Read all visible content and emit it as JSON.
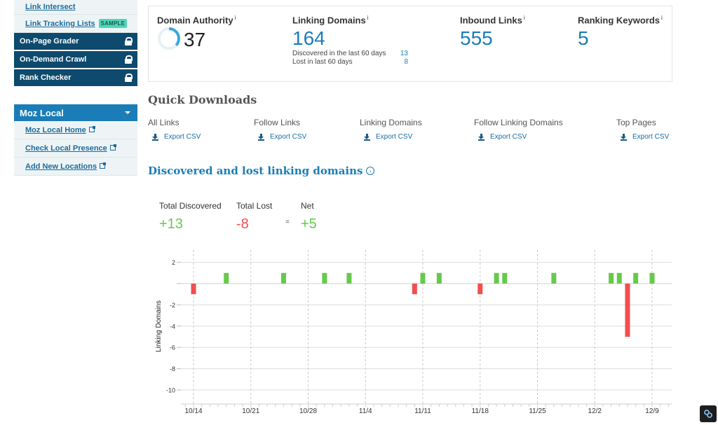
{
  "sidebar": {
    "top_links": [
      {
        "label": "Link Intersect"
      },
      {
        "label": "Link Tracking Lists",
        "badge": "SAMPLE"
      }
    ],
    "locked_items": [
      {
        "label": "On-Page Grader"
      },
      {
        "label": "On-Demand Crawl"
      },
      {
        "label": "Rank Checker"
      }
    ],
    "moz_local": {
      "title": "Moz Local",
      "links": [
        {
          "label": "Moz Local Home"
        },
        {
          "label": "Check Local Presence"
        },
        {
          "label": "Add New Locations"
        }
      ]
    }
  },
  "metrics": {
    "domain_authority": {
      "label": "Domain Authority",
      "info": "i",
      "value": "37",
      "score": 37
    },
    "linking_domains": {
      "label": "Linking Domains",
      "info": "i",
      "value": "164",
      "discovered_label": "Discovered in the last 60 days",
      "discovered_value": "13",
      "lost_label": "Lost in last 60 days",
      "lost_value": "8"
    },
    "inbound_links": {
      "label": "Inbound Links",
      "info": "i",
      "value": "555"
    },
    "ranking_keywords": {
      "label": "Ranking Keywords",
      "info": "i",
      "value": "5"
    }
  },
  "quick_downloads": {
    "title": "Quick Downloads",
    "items": [
      {
        "label": "All Links",
        "action": "Export CSV"
      },
      {
        "label": "Follow Links",
        "action": "Export CSV"
      },
      {
        "label": "Linking Domains",
        "action": "Export CSV"
      },
      {
        "label": "Follow Linking Domains",
        "action": "Export CSV"
      },
      {
        "label": "Top Pages",
        "action": "Export CSV"
      }
    ]
  },
  "discovered_lost": {
    "title": "Discovered and lost linking domains",
    "total_discovered_label": "Total Discovered",
    "total_discovered": "+13",
    "total_lost_label": "Total Lost",
    "total_lost": "-8",
    "equals": "=",
    "net_label": "Net",
    "net": "+5"
  },
  "colors": {
    "accent": "#1b7db7",
    "sidebar_dark": "#0e4a6e",
    "gained": "#67c94b",
    "lost": "#f24e4e"
  },
  "chart_data": {
    "type": "bar",
    "title": "",
    "xlabel": "",
    "ylabel": "Linking Domains",
    "ylim": [
      -11,
      2.5
    ],
    "yticks": [
      2,
      0,
      -2,
      -4,
      -6,
      -8,
      -10
    ],
    "ytick_labels": [
      "2",
      "",
      "-2",
      "-4",
      "-6",
      "-8",
      "-10"
    ],
    "x_range_days": [
      -2,
      58
    ],
    "xtick_days": [
      0,
      7,
      14,
      21,
      28,
      35,
      42,
      49,
      56
    ],
    "xtick_labels": [
      "10/14",
      "10/21",
      "10/28",
      "11/4",
      "11/11",
      "11/18",
      "11/25",
      "12/2",
      "12/9"
    ],
    "grid": true,
    "series": [
      {
        "name": "Discovered",
        "color": "#67c94b",
        "points": [
          {
            "date": "10/18",
            "day": 4,
            "value": 1
          },
          {
            "date": "10/25",
            "day": 11,
            "value": 1
          },
          {
            "date": "10/30",
            "day": 16,
            "value": 1
          },
          {
            "date": "11/2",
            "day": 19,
            "value": 1
          },
          {
            "date": "11/11",
            "day": 28,
            "value": 1
          },
          {
            "date": "11/13",
            "day": 30,
            "value": 1
          },
          {
            "date": "11/20",
            "day": 37,
            "value": 1
          },
          {
            "date": "11/21",
            "day": 38,
            "value": 1
          },
          {
            "date": "11/27",
            "day": 44,
            "value": 1
          },
          {
            "date": "12/4",
            "day": 51,
            "value": 1
          },
          {
            "date": "12/5",
            "day": 52,
            "value": 1
          },
          {
            "date": "12/7",
            "day": 54,
            "value": 1
          },
          {
            "date": "12/9",
            "day": 56,
            "value": 1
          }
        ]
      },
      {
        "name": "Lost",
        "color": "#f24e4e",
        "points": [
          {
            "date": "10/14",
            "day": 0,
            "value": -1
          },
          {
            "date": "11/10",
            "day": 27,
            "value": -1
          },
          {
            "date": "11/18",
            "day": 35,
            "value": -1
          },
          {
            "date": "12/6",
            "day": 53,
            "value": -5
          }
        ]
      }
    ]
  }
}
